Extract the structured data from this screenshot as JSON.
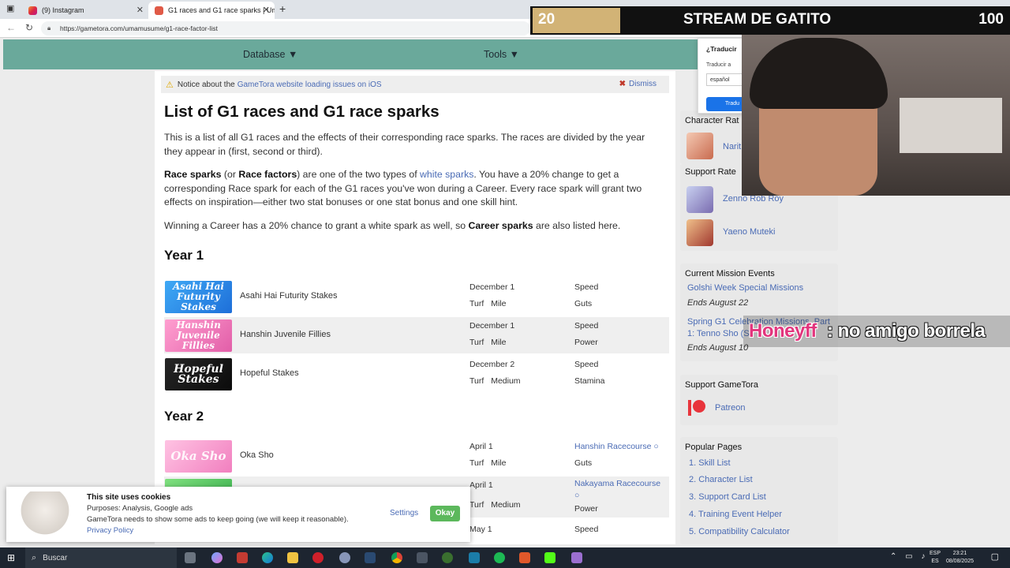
{
  "browser": {
    "tabs": [
      {
        "label": "(9) Instagram"
      },
      {
        "label": "G1 races and G1 race sparks | Um"
      }
    ],
    "url": "https://gametora.com/umamusume/g1-race-factor-list"
  },
  "site": {
    "menu": [
      {
        "label": "Database ▼"
      },
      {
        "label": "Tools ▼"
      }
    ],
    "notice": {
      "prefix": "Notice about the",
      "link": "GameTora website loading issues on iOS",
      "dismiss": "Dismiss"
    },
    "title": "List of G1 races and G1 race sparks",
    "intro": "This is a list of all G1 races and the effects of their corresponding race sparks. The races are divided by the year they appear in (first, second or third).",
    "para2": {
      "b1": "Race sparks",
      "t1": " (or ",
      "b2": "Race factors",
      "t2": ") are one of the two types of ",
      "link": "white sparks",
      "t3": ". You have a 20% change to get a corresponding Race spark for each of the G1 races you've won during a Career. Every race spark will grant two effects on inspiration—either two stat bonuses or one stat bonus and one skill hint."
    },
    "para3": {
      "t1": "Winning a Career has a 20% chance to grant a white spark as well, so ",
      "b1": "Career sparks",
      "t2": " are also listed here."
    },
    "years": [
      "Year 1",
      "Year 2"
    ],
    "year1": [
      {
        "banner": "Asahi Hai Futurity Stakes",
        "name": "Asahi Hai Futurity Stakes",
        "date": "December 1",
        "surface": "Turf",
        "distance": "Mile",
        "effect1": "Speed",
        "effect2": "Guts"
      },
      {
        "banner": "Hanshin Juvenile Fillies",
        "name": "Hanshin Juvenile Fillies",
        "date": "December 1",
        "surface": "Turf",
        "distance": "Mile",
        "effect1": "Speed",
        "effect2": "Power"
      },
      {
        "banner": "Hopeful Stakes",
        "name": "Hopeful Stakes",
        "date": "December 2",
        "surface": "Turf",
        "distance": "Medium",
        "effect1": "Speed",
        "effect2": "Stamina"
      }
    ],
    "year2": [
      {
        "banner": "Oka Sho",
        "name": "Oka Sho",
        "date": "April 1",
        "surface": "Turf",
        "distance": "Mile",
        "effect1": "Hanshin Racecourse ○",
        "effect2": "Guts"
      },
      {
        "banner": "",
        "name": "",
        "date": "April 1",
        "surface": "Turf",
        "distance": "Medium",
        "effect1": "Nakayama Racecourse ○",
        "effect2": "Power"
      },
      {
        "banner": "",
        "name": "",
        "date": "May 1",
        "surface": "",
        "distance": "",
        "effect1": "Speed",
        "effect2": ""
      }
    ]
  },
  "sidebar": {
    "character_rate_head": "Character Rat",
    "character_rate_item": "Narit",
    "support_rate_head": "Support Rate",
    "support_items": [
      "Zenno Rob Roy",
      "Yaeno Muteki"
    ],
    "mission_head": "Current Mission Events",
    "missions": [
      {
        "title": "Golshi Week Special Missions",
        "ends": "Ends August 22"
      },
      {
        "title": "Spring G1 Celebration Missions, Part 1: Tenno Sho (S",
        "ends": "Ends August 10"
      }
    ],
    "support_head": "Support GameTora",
    "patreon": "Patreon",
    "popular_head": "Popular Pages",
    "popular": [
      "1. Skill List",
      "2. Character List",
      "3. Support Card List",
      "4. Training Event Helper",
      "5. Compatibility Calculator"
    ]
  },
  "translate_popup": {
    "title": "¿Traducir",
    "label": "Traducir a",
    "select": "español",
    "button": "Tradu"
  },
  "stream": {
    "left_value": "20",
    "title": "STREAM DE GATITO",
    "right_value": "100",
    "progress_fraction": 0.2,
    "chat_user": "Honeyff",
    "chat_message": ": no amigo borrela"
  },
  "cookie": {
    "title": "This site uses cookies",
    "purposes": "Purposes: Analysis, Google ads",
    "message": "GameTora needs to show some ads to keep going (we will keep it reasonable).",
    "privacy": "Privacy Policy",
    "settings": "Settings",
    "okay": "Okay"
  },
  "taskbar": {
    "search": "Buscar",
    "lang_top": "ESP",
    "lang_bottom": "ES",
    "time": "23:21",
    "date": "08/08/2025"
  },
  "colors": {
    "site_header": "#6aa99b",
    "link": "#4a6bb5",
    "stream_progress": "#d2b376"
  }
}
